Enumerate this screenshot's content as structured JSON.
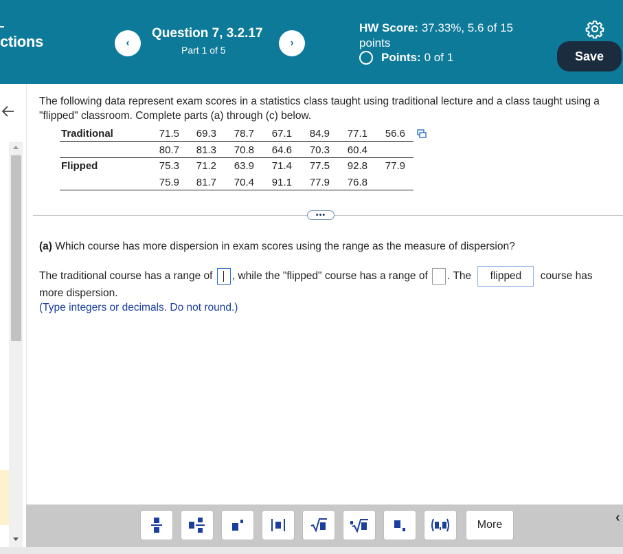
{
  "header": {
    "left_title": "ctions",
    "question_title": "Question 7, 3.2.17",
    "question_part": "Part 1 of 5",
    "hw_score_label": "HW Score:",
    "hw_score_value": "37.33%, 5.6 of 15 points",
    "points_label": "Points:",
    "points_value": "0 of 1",
    "save_label": "Save",
    "prev_glyph": "‹",
    "next_glyph": "›",
    "color": "#0e7a99"
  },
  "intro_text": "The following data represent exam scores in a statistics class taught using traditional lecture and a class taught using a \"flipped\" classroom. Complete parts (a) through (c) below.",
  "data_table": {
    "traditional_label": "Traditional",
    "flipped_label": "Flipped",
    "traditional_row1": [
      "71.5",
      "69.3",
      "78.7",
      "67.1",
      "84.9",
      "77.1",
      "56.6"
    ],
    "traditional_row2": [
      "80.7",
      "81.3",
      "70.8",
      "64.6",
      "70.3",
      "60.4"
    ],
    "flipped_row1": [
      "75.3",
      "71.2",
      "63.9",
      "71.4",
      "77.5",
      "92.8",
      "77.9"
    ],
    "flipped_row2": [
      "75.9",
      "81.7",
      "70.4",
      "91.1",
      "77.9",
      "76.8"
    ]
  },
  "ellipsis": "•••",
  "part_a": {
    "label": "(a)",
    "question": "Which course has more dispersion in exam scores using the range as the measure of dispersion?",
    "sentence_1": "The traditional course has a range of",
    "sentence_2": ", while the \"flipped\" course has a range of",
    "sentence_3": ". The",
    "selected_course": "flipped",
    "sentence_4": "course has",
    "sentence_5": "more dispersion.",
    "hint": "(Type integers or decimals. Do not round.)"
  },
  "toolbar": {
    "buttons": [
      "fraction",
      "mixed-number",
      "exponent",
      "absolute-value",
      "square-root",
      "nth-root",
      "subscript",
      "ordered-pair"
    ],
    "button_glyphs": [
      "▪/▪",
      "▪▪/▪",
      "▪'",
      "|▪|",
      "√▪",
      "ⁿ√▪",
      "▪.",
      "(▪,▪)"
    ],
    "more_label": "More"
  }
}
